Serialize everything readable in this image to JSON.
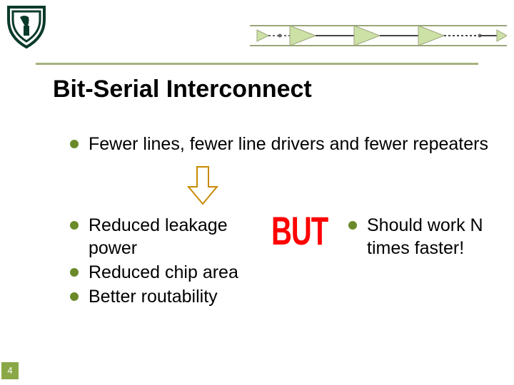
{
  "page": {
    "number": "4",
    "title": "Bit-Serial Interconnect"
  },
  "bullets": {
    "first": "Fewer lines, fewer line drivers and fewer repeaters",
    "left": [
      "Reduced leakage power",
      "Reduced chip area",
      "Better routability"
    ],
    "right": [
      "Should work N times faster!"
    ]
  },
  "but_label": "BUT",
  "icons": {
    "logo": "institution-shield-logo",
    "chain": "driver-repeater-chain",
    "arrow": "outline-down-arrow"
  },
  "colors": {
    "accent": "#6a8a2a",
    "but": "#ff0000"
  }
}
